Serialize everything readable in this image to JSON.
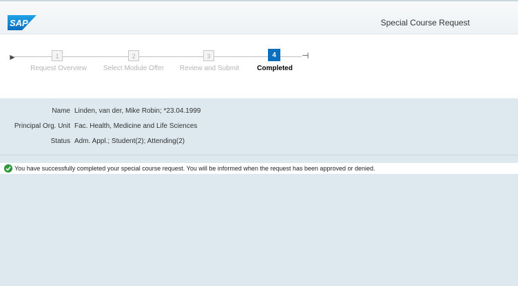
{
  "header": {
    "logo_text": "SAP",
    "title": "Special Course Request"
  },
  "roadmap": {
    "steps": [
      {
        "number": "1",
        "label": "Request Overview"
      },
      {
        "number": "2",
        "label": "Select Module Offer"
      },
      {
        "number": "3",
        "label": "Review and Submit"
      },
      {
        "number": "4",
        "label": "Completed"
      }
    ],
    "current_step": 4
  },
  "info": {
    "name_label": "Name",
    "name_value": "Linden, van der, Mike Robin; *23.04.1999",
    "org_label": "Principal Org. Unit",
    "org_value": "Fac. Health, Medicine and Life Sciences",
    "status_label": "Status",
    "status_value": "Adm. Appl.; Student(2); Attending(2)"
  },
  "message": {
    "icon": "success-check-icon",
    "text": "You have successfully completed your special course request. You will be informed when the request has been approved or denied."
  },
  "colors": {
    "brand_blue": "#0b6fbd",
    "success_green": "#2e9a3c",
    "page_bg": "#dde9ee"
  }
}
